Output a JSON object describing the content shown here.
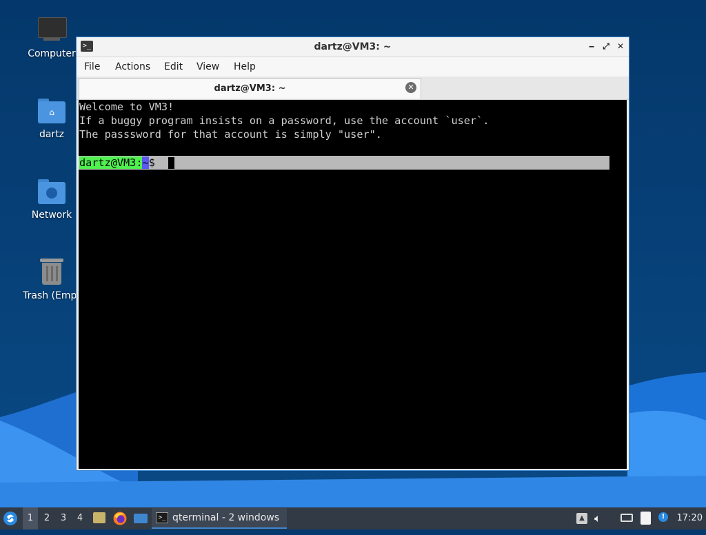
{
  "colors": {
    "accent": "#3f86d1",
    "terminal_bg": "#000000",
    "prompt_user_bg": "#4ff04f",
    "prompt_path_bg": "#5a5af0",
    "taskbar_bg": "#323a45"
  },
  "desktop": {
    "icons": [
      {
        "label": "Computer",
        "icon": "computer-icon"
      },
      {
        "label": "dartz",
        "icon": "home-folder-icon"
      },
      {
        "label": "Network",
        "icon": "network-folder-icon"
      },
      {
        "label": "Trash (Empt",
        "icon": "trash-icon"
      }
    ]
  },
  "window": {
    "title": "dartz@VM3: ~",
    "app_icon": ">_",
    "controls": {
      "minimize": "‒",
      "maximize": "⤢",
      "close": "✕"
    },
    "menu": [
      "File",
      "Actions",
      "Edit",
      "View",
      "Help"
    ],
    "tab": {
      "title": "dartz@VM3: ~",
      "close": "✕"
    },
    "terminal": {
      "lines": [
        "Welcome to VM3!",
        "If a buggy program insists on a password, use the account `user`.",
        "The passsword for that account is simply \"user\"."
      ],
      "prompt": {
        "user": "dartz",
        "at": "@",
        "host": "VM3",
        "sep": ":",
        "path": "~",
        "dollar": "$"
      }
    }
  },
  "taskbar": {
    "start_icon": "lxqt-menu-icon",
    "workspaces": [
      "1",
      "2",
      "3",
      "4"
    ],
    "active_workspace": "1",
    "quicklaunch": [
      "file-manager-icon",
      "firefox-icon",
      "show-desktop-icon"
    ],
    "task": {
      "label": "qterminal - 2 windows",
      "icon": "terminal-icon"
    },
    "tray": [
      "tray-up-arrow-icon",
      "volume-icon",
      "network-icon",
      "clipboard-icon",
      "update-notifier-icon"
    ],
    "clock": "17:20"
  }
}
